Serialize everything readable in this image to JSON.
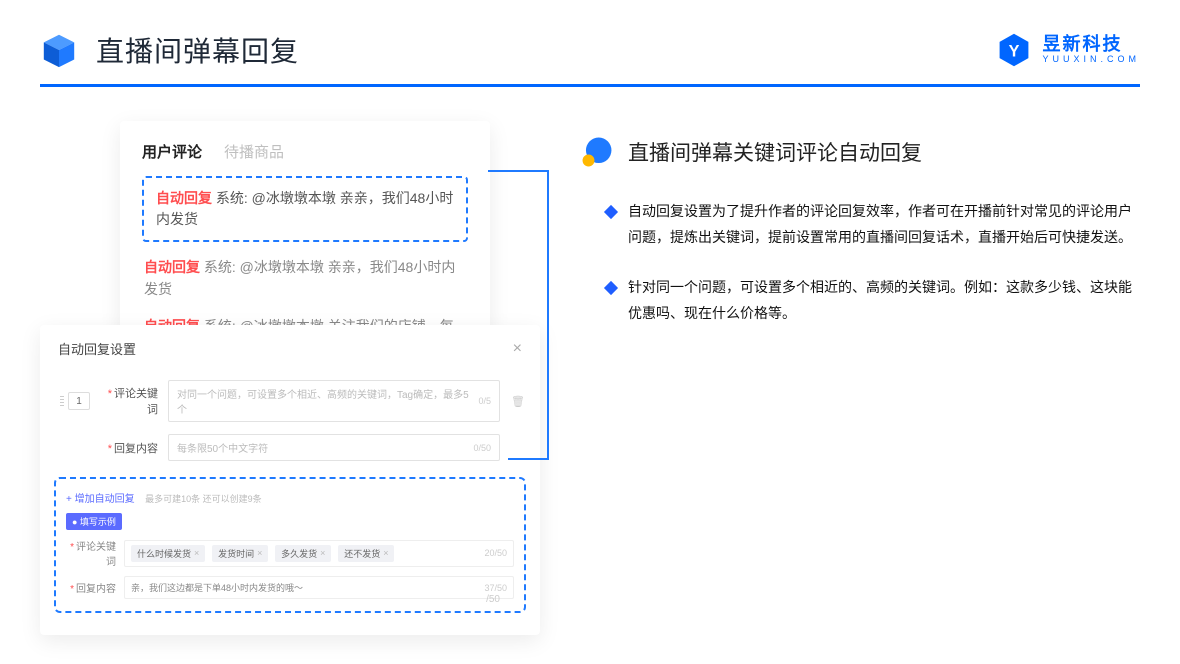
{
  "header": {
    "title": "直播间弹幕回复",
    "brand_name": "昱新科技",
    "brand_sub": "YUUXIN.COM"
  },
  "comment_card": {
    "tab_active": "用户评论",
    "tab_inactive": "待播商品",
    "auto_tag": "自动回复",
    "cmt1": "系统: @冰墩墩本墩 亲亲，我们48小时内发货",
    "cmt2": "系统: @冰墩墩本墩 亲亲，我们48小时内发货",
    "cmt3": "系统: @冰墩墩本墩 关注我们的店铺，每日都有热门推荐呦～"
  },
  "settings": {
    "title": "自动回复设置",
    "index": "1",
    "label_keyword": "评论关键词",
    "placeholder_keyword": "对同一个问题，可设置多个相近、高频的关键词，Tag确定，最多5个",
    "counter_keyword": "0/5",
    "label_reply": "回复内容",
    "placeholder_reply": "每条限50个中文字符",
    "counter_reply": "0/50",
    "add_link": "+ 增加自动回复",
    "add_hint": "最多可建10条 还可以创建9条",
    "example_tag": "● 填写示例",
    "ex_label_keyword": "评论关键词",
    "ex_tags": [
      "什么时候发货",
      "发货时间",
      "多久发货",
      "还不发货"
    ],
    "ex_counter1": "20/50",
    "ex_label_reply": "回复内容",
    "ex_reply_text": "亲，我们这边都是下单48小时内发货的哦～",
    "ex_counter2": "37/50",
    "outer_counter": "/50"
  },
  "right": {
    "title": "直播间弹幕关键词评论自动回复",
    "bullet1": "自动回复设置为了提升作者的评论回复效率，作者可在开播前针对常见的评论用户问题，提炼出关键词，提前设置常用的直播间回复话术，直播开始后可快捷发送。",
    "bullet2": "针对同一个问题，可设置多个相近的、高频的关键词。例如：这款多少钱、这块能优惠吗、现在什么价格等。"
  }
}
